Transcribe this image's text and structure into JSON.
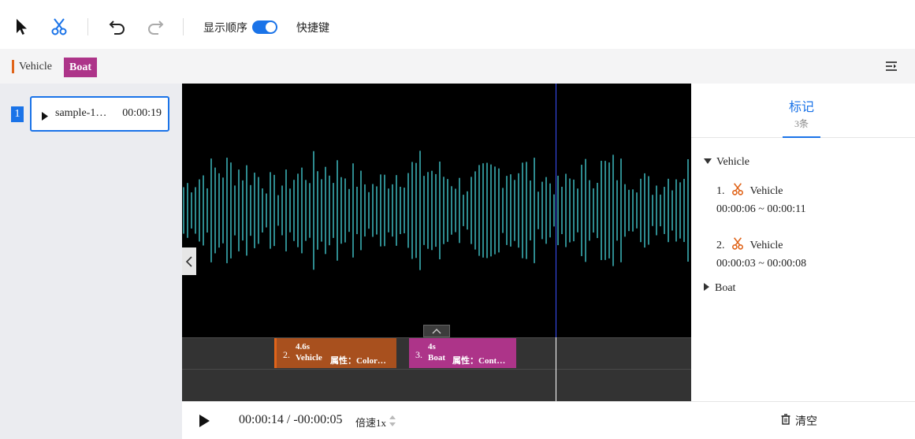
{
  "toolbar": {
    "show_order_label": "显示顺序",
    "show_order_on": true,
    "shortcuts_label": "快捷键",
    "select_tool_icon": "cursor-icon",
    "cut_tool_icon": "scissors-icon",
    "undo_icon": "undo-icon",
    "redo_icon": "redo-icon",
    "accent_color": "#1a73e8"
  },
  "labels": [
    {
      "name": "Vehicle",
      "color": "#e0641a"
    },
    {
      "name": "Boat",
      "color": "#ad3489"
    }
  ],
  "file_list": {
    "items": [
      {
        "index": "1",
        "name": "sample-1…",
        "duration": "00:00:19"
      }
    ]
  },
  "segments": [
    {
      "num": "2.",
      "dur": "4.6s",
      "name": "Vehicle",
      "attr": "属性：Color…",
      "color": "#a8501e"
    },
    {
      "num": "3.",
      "dur": "4s",
      "name": "Boat",
      "attr": "属性：Cont…",
      "color": "#ad3489"
    }
  ],
  "player": {
    "time": "00:00:14 / -00:00:05",
    "speed_label": "倍速1x",
    "clear_label": "清空"
  },
  "marks_panel": {
    "tab_title": "标记",
    "tab_count": "3条",
    "groups": [
      {
        "name": "Vehicle",
        "expanded": true,
        "items": [
          {
            "index": "1.",
            "label": "Vehicle",
            "range": "00:00:06 ~ 00:00:11"
          },
          {
            "index": "2.",
            "label": "Vehicle",
            "range": "00:00:03 ~ 00:00:08"
          }
        ]
      },
      {
        "name": "Boat",
        "expanded": false,
        "items": []
      }
    ]
  },
  "waveform_color": "#2e8b8f"
}
